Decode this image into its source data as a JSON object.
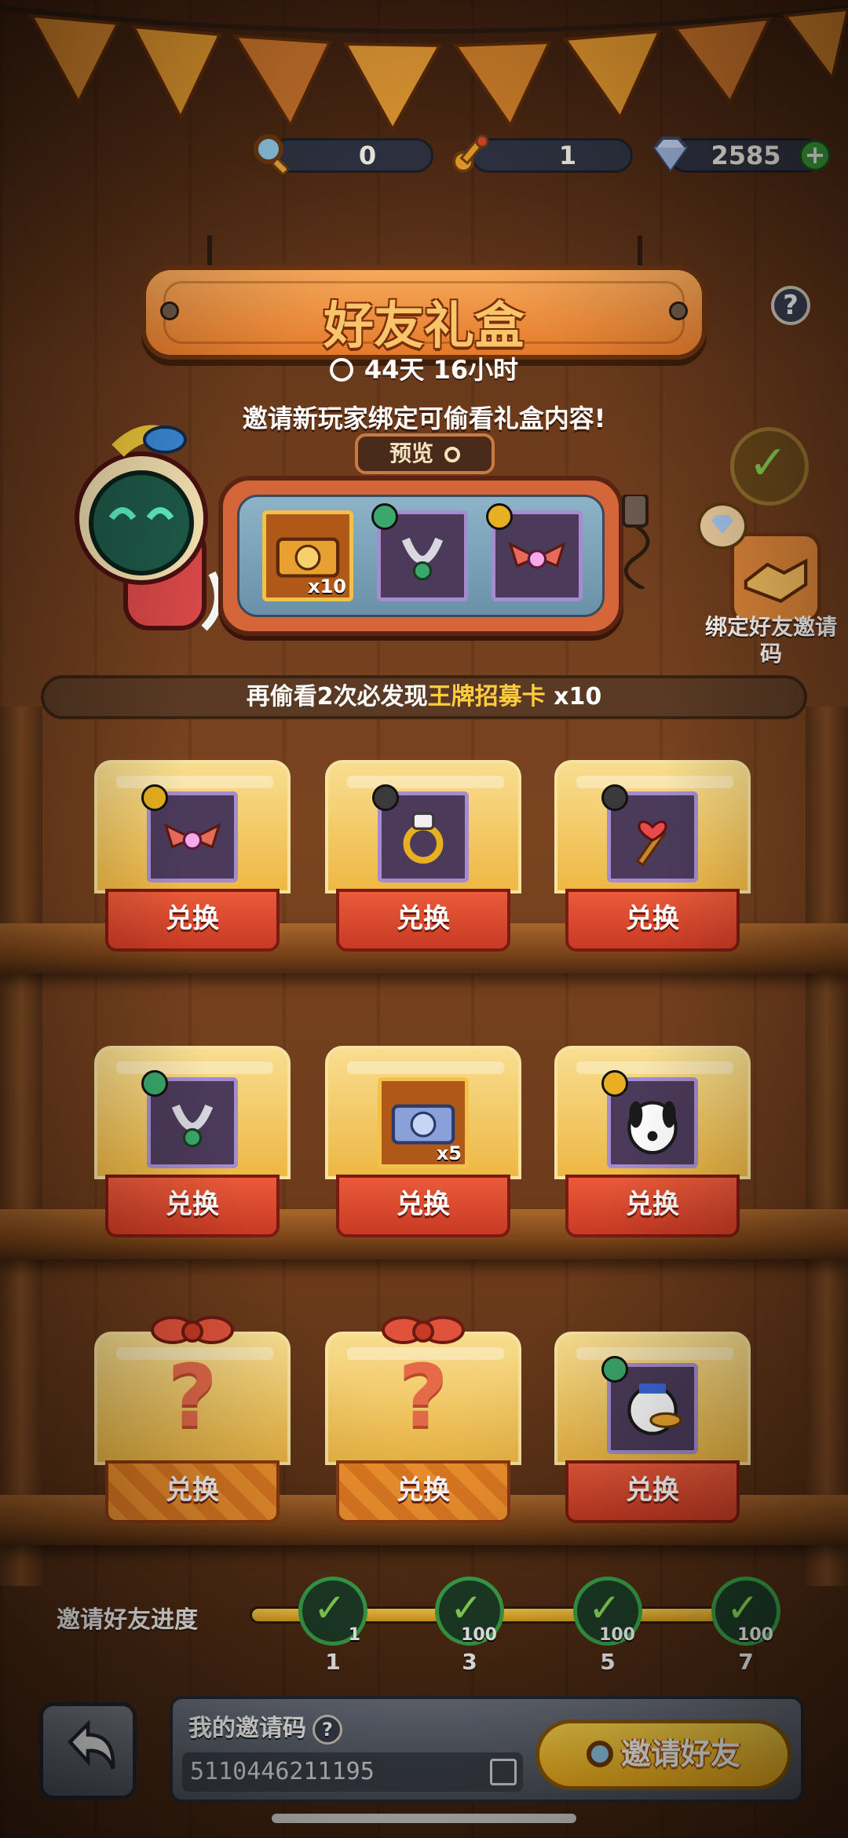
{
  "currency": {
    "magnifier": "0",
    "key": "1",
    "diamond": "2585"
  },
  "banner": {
    "title": "好友礼盒"
  },
  "timer": "44天 16小时",
  "subtitle": "邀请新玩家绑定可偷看礼盒内容!",
  "preview": {
    "tag": "预览",
    "items": [
      {
        "icon": "ticket-icon",
        "count": "x10",
        "frame": "gold"
      },
      {
        "icon": "ring-icon",
        "count": "",
        "badge": "g"
      },
      {
        "icon": "wings-icon",
        "count": "",
        "badge": "y"
      }
    ]
  },
  "side": {
    "bind_label": "绑定好友邀请码"
  },
  "hint": {
    "before": "再偷看2次必发现",
    "highlight": "王牌招募卡",
    "after": " x10"
  },
  "exchange_label": "兑换",
  "grid": [
    {
      "icon": "wings-icon",
      "count": "",
      "badge": "y"
    },
    {
      "icon": "gem-ring-icon",
      "count": "",
      "badge": "d"
    },
    {
      "icon": "heart-wand-icon",
      "count": "",
      "badge": "d"
    },
    {
      "icon": "ring-icon",
      "count": "",
      "badge": "g"
    },
    {
      "icon": "ticket-icon",
      "count": "x5",
      "frame": "gold"
    },
    {
      "icon": "dog-card-icon",
      "count": "",
      "badge": "y"
    },
    {
      "icon": "mystery-icon",
      "locked": true
    },
    {
      "icon": "mystery-icon",
      "locked": true
    },
    {
      "icon": "duck-card-icon",
      "count": "",
      "badge": "g"
    }
  ],
  "progress": {
    "label": "邀请好友进度",
    "fill": 1.0,
    "nodes": [
      {
        "step": "1",
        "reward": "1"
      },
      {
        "step": "3",
        "reward": "100"
      },
      {
        "step": "5",
        "reward": "100"
      },
      {
        "step": "7",
        "reward": "100"
      }
    ]
  },
  "bottom": {
    "code_title": "我的邀请码",
    "code_value": "5110446211195",
    "invite_label": "邀请好友"
  }
}
